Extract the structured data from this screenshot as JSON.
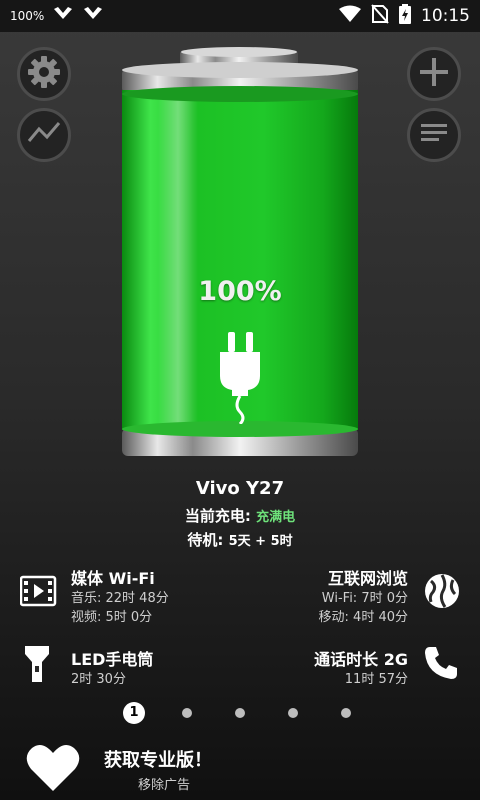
{
  "status_bar": {
    "battery_percent_text": "100%",
    "time": "10:15"
  },
  "battery": {
    "level_text": "100%",
    "level": 1.0
  },
  "device": {
    "name": "Vivo Y27",
    "charging_label": "当前充电:",
    "charging_value": "充满电",
    "standby_label": "待机:",
    "standby_value": "5天 + 5时"
  },
  "usage": {
    "media_wifi": {
      "title": "媒体 Wi-Fi",
      "line1": "音乐: 22时 48分",
      "line2": "视频: 5时 0分"
    },
    "internet": {
      "title": "互联网浏览",
      "line1": "Wi-Fi: 7时 0分",
      "line2": "移动: 4时 40分"
    },
    "flashlight": {
      "title": "LED手电筒",
      "line1": "2时 30分"
    },
    "talk": {
      "title": "通话时长 2G",
      "line1": "11时 57分"
    }
  },
  "pager": {
    "active_label": "1",
    "total": 5,
    "active_index": 0
  },
  "promo": {
    "title": "获取专业版！",
    "subtitle": "移除广告"
  },
  "colors": {
    "battery_green": "#22c72a",
    "charge_value": "#6ee17a",
    "background": "#2a2a2a"
  },
  "icons": [
    "settings-icon",
    "add-icon",
    "chart-icon",
    "list-icon",
    "media-icon",
    "globe-icon",
    "flashlight-icon",
    "phone-icon",
    "heart-icon",
    "plug-icon"
  ]
}
